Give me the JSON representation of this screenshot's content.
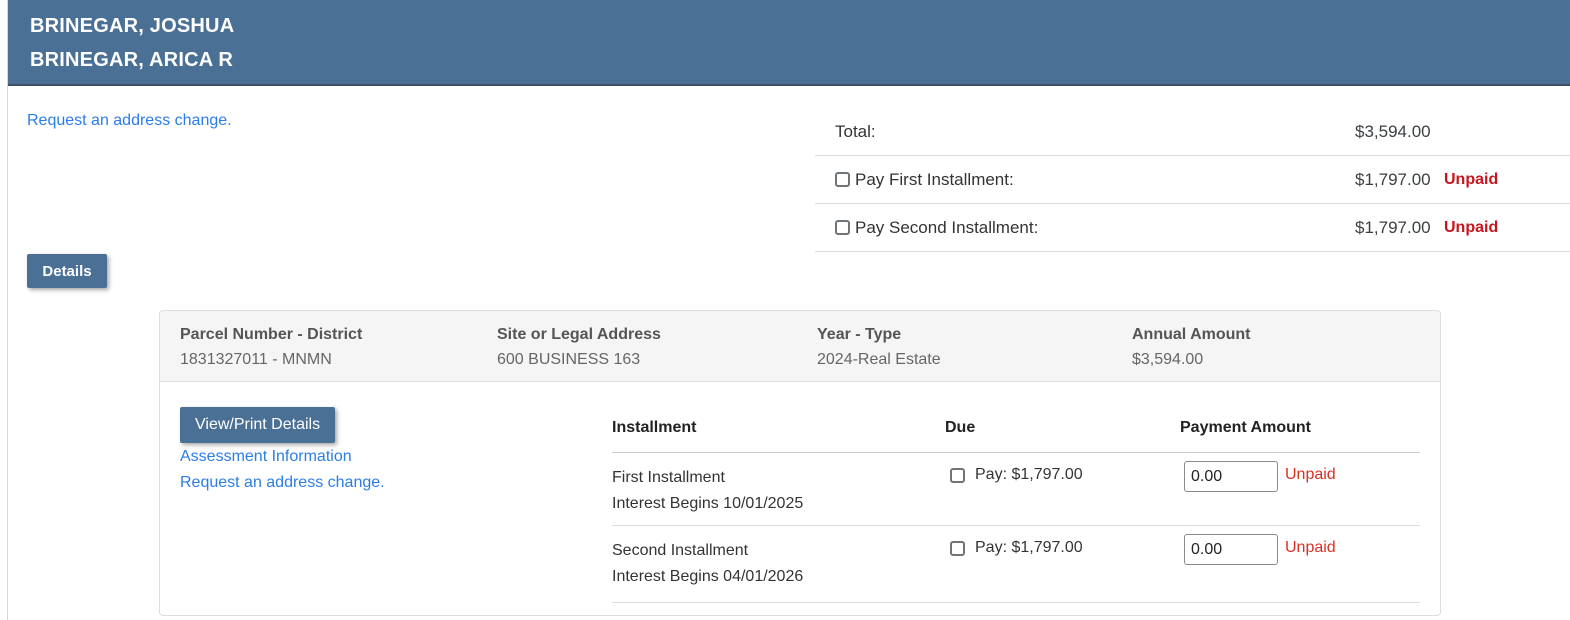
{
  "header": {
    "names": [
      "BRINEGAR, JOSHUA",
      "BRINEGAR, ARICA R"
    ]
  },
  "top": {
    "address_change_link": "Request an address change."
  },
  "summary": {
    "total_label": "Total:",
    "total_amount": "$3,594.00",
    "rows": [
      {
        "label": "Pay First Installment:",
        "amount": "$1,797.00",
        "status": "Unpaid"
      },
      {
        "label": "Pay Second Installment:",
        "amount": "$1,797.00",
        "status": "Unpaid"
      }
    ]
  },
  "buttons": {
    "details": "Details",
    "view_print": "View/Print Details"
  },
  "parcel": {
    "columns": [
      {
        "label": "Parcel Number - District",
        "value": "1831327011 - MNMN"
      },
      {
        "label": "Site or Legal Address",
        "value": "600 BUSINESS 163"
      },
      {
        "label": "Year - Type",
        "value": "2024-Real Estate"
      },
      {
        "label": "Annual Amount",
        "value": "$3,594.00"
      }
    ]
  },
  "panel_links": {
    "assessment": "Assessment Information",
    "address_change": "Request an address change."
  },
  "installments": {
    "headers": {
      "installment": "Installment",
      "due": "Due",
      "payment": "Payment Amount"
    },
    "rows": [
      {
        "name": "First Installment",
        "interest": "Interest Begins 10/01/2025",
        "due": "Pay: $1,797.00",
        "amount_value": "0.00",
        "status": "Unpaid"
      },
      {
        "name": "Second Installment",
        "interest": "Interest Begins 04/01/2026",
        "due": "Pay: $1,797.00",
        "amount_value": "0.00",
        "status": "Unpaid"
      }
    ]
  },
  "colors": {
    "header_bg": "#4a7096",
    "header_border": "#3e4f63",
    "link": "#2b7de9",
    "button_bg": "#4a7096",
    "unpaid_bold": "#c5161d",
    "unpaid": "#d93025",
    "panel_head_bg": "#f5f5f5",
    "border": "#dcdcdc",
    "text": "#333333",
    "muted": "#666666"
  }
}
